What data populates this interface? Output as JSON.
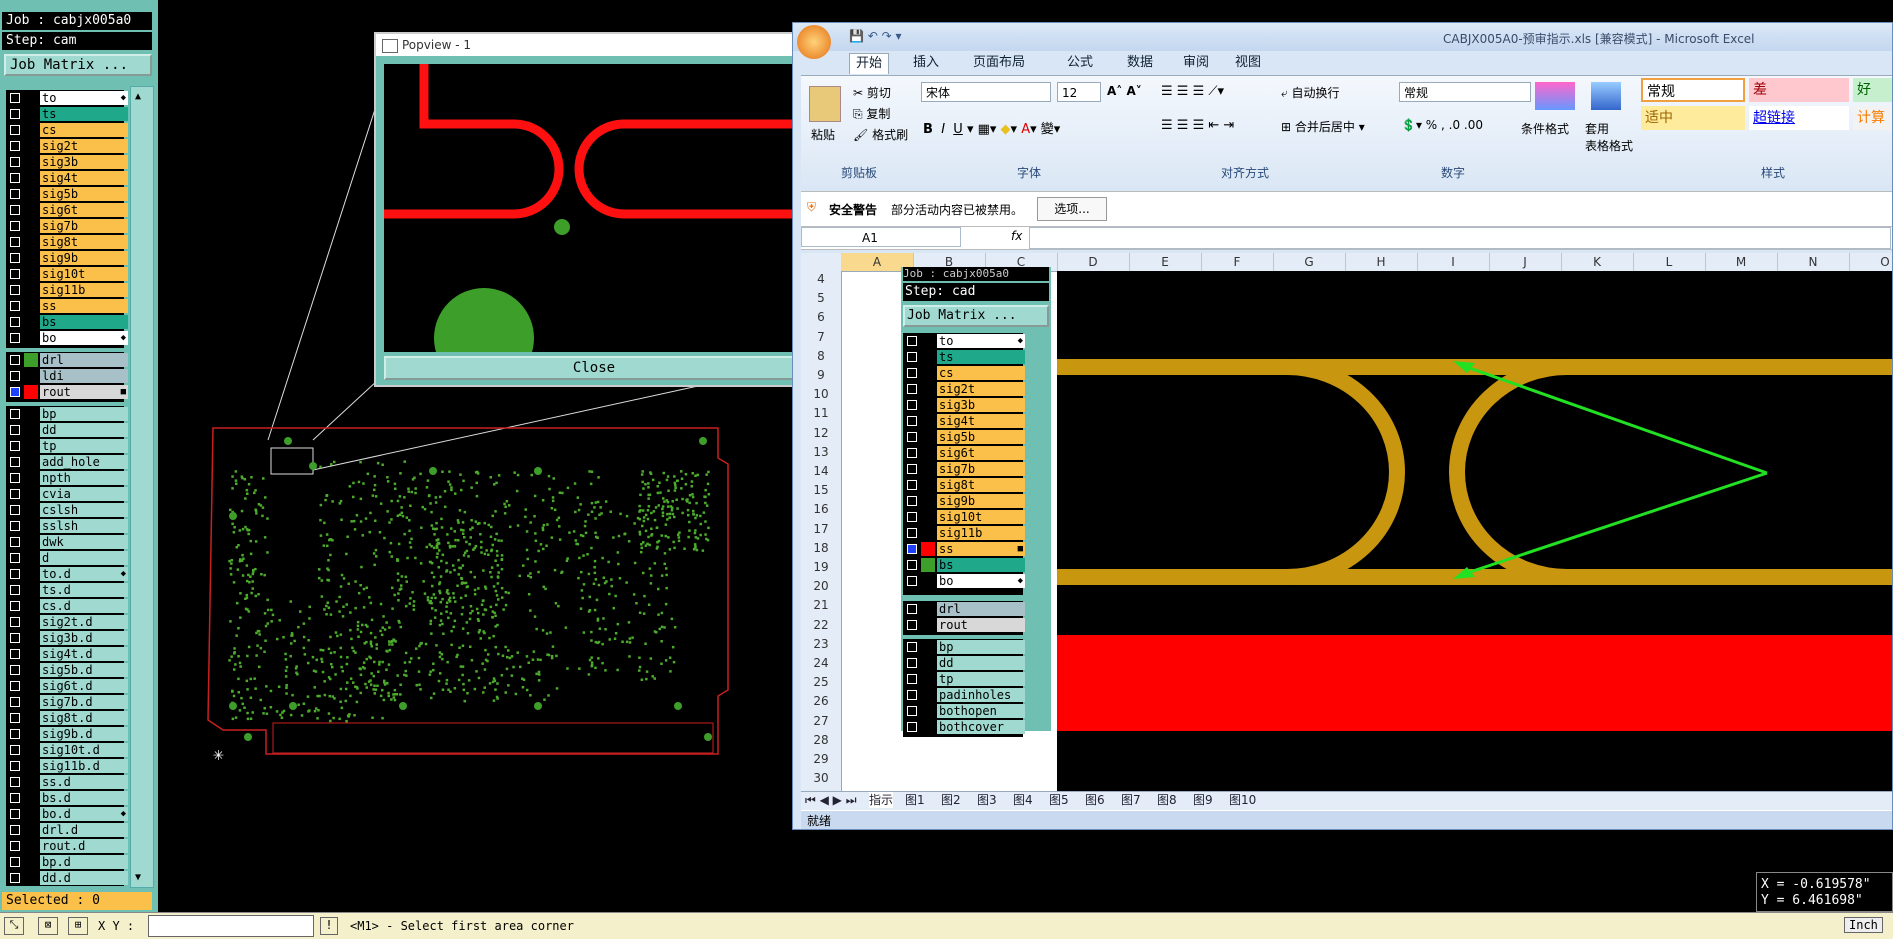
{
  "cam": {
    "job": "Job : cabjx005a0",
    "step": "Step: cam",
    "job_matrix_btn": "Job Matrix ...",
    "layers_group1": [
      {
        "name": "to",
        "color": "#ffffff",
        "flag": "◆"
      },
      {
        "name": "ts",
        "color": "#1fa88a",
        "flag": ""
      },
      {
        "name": "cs",
        "color": "#fbc04a",
        "flag": ""
      },
      {
        "name": "sig2t",
        "color": "#fbc04a",
        "flag": ""
      },
      {
        "name": "sig3b",
        "color": "#fbc04a",
        "flag": ""
      },
      {
        "name": "sig4t",
        "color": "#fbc04a",
        "flag": ""
      },
      {
        "name": "sig5b",
        "color": "#fbc04a",
        "flag": ""
      },
      {
        "name": "sig6t",
        "color": "#fbc04a",
        "flag": ""
      },
      {
        "name": "sig7b",
        "color": "#fbc04a",
        "flag": ""
      },
      {
        "name": "sig8t",
        "color": "#fbc04a",
        "flag": ""
      },
      {
        "name": "sig9b",
        "color": "#fbc04a",
        "flag": ""
      },
      {
        "name": "sig10t",
        "color": "#fbc04a",
        "flag": ""
      },
      {
        "name": "sig11b",
        "color": "#fbc04a",
        "flag": ""
      },
      {
        "name": "ss",
        "color": "#fbc04a",
        "flag": ""
      },
      {
        "name": "bs",
        "color": "#1fa88a",
        "flag": ""
      },
      {
        "name": "bo",
        "color": "#ffffff",
        "flag": "◆"
      }
    ],
    "layers_group2": [
      {
        "name": "drl",
        "color": "#a8c0c8",
        "swatch": "#3d9e2a",
        "flag": ""
      },
      {
        "name": "ldi",
        "color": "#a8c0c8",
        "swatch": "",
        "flag": ""
      },
      {
        "name": "rout",
        "color": "#d8d8d8",
        "swatch": "#ff0000",
        "flag": "■"
      }
    ],
    "layers_group3": [
      {
        "name": "bp"
      },
      {
        "name": "dd"
      },
      {
        "name": "tp"
      },
      {
        "name": "add_hole"
      },
      {
        "name": "npth"
      },
      {
        "name": "cvia"
      },
      {
        "name": "cslsh"
      },
      {
        "name": "sslsh"
      },
      {
        "name": "dwk"
      },
      {
        "name": "d"
      },
      {
        "name": "to.d"
      },
      {
        "name": "ts.d"
      },
      {
        "name": "cs.d"
      },
      {
        "name": "sig2t.d"
      },
      {
        "name": "sig3b.d"
      },
      {
        "name": "sig4t.d"
      },
      {
        "name": "sig5b.d"
      },
      {
        "name": "sig6t.d"
      },
      {
        "name": "sig7b.d"
      },
      {
        "name": "sig8t.d"
      },
      {
        "name": "sig9b.d"
      },
      {
        "name": "sig10t.d"
      },
      {
        "name": "sig11b.d"
      },
      {
        "name": "ss.d"
      },
      {
        "name": "bs.d"
      },
      {
        "name": "bo.d"
      },
      {
        "name": "drl.d"
      },
      {
        "name": "rout.d"
      },
      {
        "name": "bp.d"
      },
      {
        "name": "dd.d"
      }
    ],
    "selected": "Selected : 0",
    "coord_x": "X = -0.619578\"",
    "coord_y": "Y =  6.461698\"",
    "status_xy": "X Y :",
    "status_msg": "<M1> - Select first area corner",
    "status_right": "Inch"
  },
  "popview": {
    "title": "Popview - 1",
    "close_label": "Close"
  },
  "excel": {
    "title": "CABJX005A0-预审指示.xls [兼容模式] - Microsoft Excel",
    "tabs": [
      "开始",
      "插入",
      "页面布局",
      "公式",
      "数据",
      "审阅",
      "视图"
    ],
    "clipboard": {
      "paste": "粘贴",
      "cut": "剪切",
      "copy": "复制",
      "format_painter": "格式刷",
      "label": "剪贴板"
    },
    "font": {
      "name": "宋体",
      "size": "12",
      "label": "字体"
    },
    "alignment": {
      "wrap": "自动换行",
      "merge": "合并后居中",
      "label": "对齐方式"
    },
    "number": {
      "format": "常规",
      "label": "数字"
    },
    "styles": {
      "cond": "条件格式",
      "table": "套用\n表格格式",
      "label": "样式",
      "cells": [
        "常规",
        "差",
        "好",
        "适中",
        "超链接",
        "计算"
      ]
    },
    "security": {
      "title": "安全警告",
      "msg": "部分活动内容已被禁用。",
      "btn": "选项..."
    },
    "namebox": "A1",
    "fx": "fx",
    "columns": [
      "A",
      "B",
      "C",
      "D",
      "E",
      "F",
      "G",
      "H",
      "I",
      "J",
      "K",
      "L",
      "M",
      "N",
      "O"
    ],
    "rows": [
      "4",
      "5",
      "6",
      "7",
      "8",
      "9",
      "10",
      "11",
      "12",
      "13",
      "14",
      "15",
      "16",
      "17",
      "18",
      "19",
      "20",
      "21",
      "22",
      "23",
      "24",
      "25",
      "26",
      "27",
      "28",
      "29",
      "30"
    ],
    "sheets": [
      "指示",
      "图1",
      "图2",
      "图3",
      "图4",
      "图5",
      "图6",
      "图7",
      "图8",
      "图9",
      "图10"
    ],
    "status": "就绪",
    "embedded": {
      "job": "Job : cabjx005a0",
      "step": "Step: cad",
      "job_matrix_btn": "Job Matrix ...",
      "layers_a": [
        {
          "name": "to",
          "color": "#ffffff",
          "swatch": "",
          "flag": "◆"
        },
        {
          "name": "ts",
          "color": "#1fa88a",
          "swatch": "",
          "flag": ""
        },
        {
          "name": "cs",
          "color": "#fbc04a",
          "swatch": "",
          "flag": ""
        },
        {
          "name": "sig2t",
          "color": "#fbc04a",
          "swatch": "",
          "flag": ""
        },
        {
          "name": "sig3b",
          "color": "#fbc04a",
          "swatch": "",
          "flag": ""
        },
        {
          "name": "sig4t",
          "color": "#fbc04a",
          "swatch": "",
          "flag": ""
        },
        {
          "name": "sig5b",
          "color": "#fbc04a",
          "swatch": "",
          "flag": ""
        },
        {
          "name": "sig6t",
          "color": "#fbc04a",
          "swatch": "",
          "flag": ""
        },
        {
          "name": "sig7b",
          "color": "#fbc04a",
          "swatch": "",
          "flag": ""
        },
        {
          "name": "sig8t",
          "color": "#fbc04a",
          "swatch": "",
          "flag": ""
        },
        {
          "name": "sig9b",
          "color": "#fbc04a",
          "swatch": "",
          "flag": ""
        },
        {
          "name": "sig10t",
          "color": "#fbc04a",
          "swatch": "",
          "flag": ""
        },
        {
          "name": "sig11b",
          "color": "#fbc04a",
          "swatch": "",
          "flag": ""
        },
        {
          "name": "ss",
          "color": "#fbc04a",
          "swatch": "#ff0000",
          "flag": "■"
        },
        {
          "name": "bs",
          "color": "#1fa88a",
          "swatch": "#3d9e2a",
          "flag": ""
        },
        {
          "name": "bo",
          "color": "#ffffff",
          "swatch": "",
          "flag": "◆"
        }
      ],
      "layers_b": [
        {
          "name": "drl",
          "color": "#a8c0c8"
        },
        {
          "name": "rout",
          "color": "#d8d8d8"
        }
      ],
      "layers_c": [
        {
          "name": "bp"
        },
        {
          "name": "dd"
        },
        {
          "name": "tp"
        },
        {
          "name": "padinholes"
        },
        {
          "name": "bothopen"
        },
        {
          "name": "bothcover"
        }
      ]
    }
  }
}
